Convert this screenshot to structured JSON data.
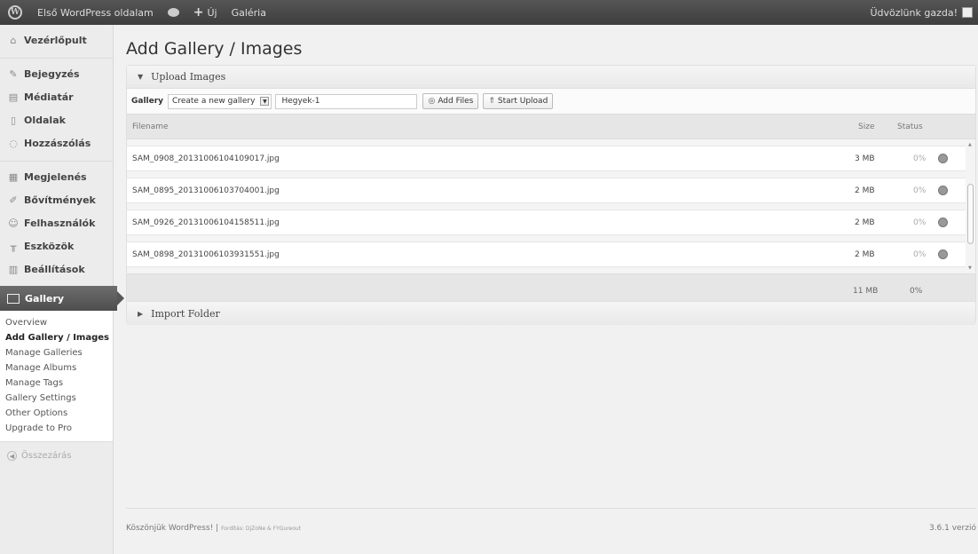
{
  "adminbar": {
    "site_name": "Első WordPress oldalam",
    "new_label": "Új",
    "gallery_link": "Galéria",
    "greeting": "Üdvözlünk gazda!"
  },
  "sidebar": {
    "items": [
      {
        "label": "Vezérlőpult",
        "icon": "dashboard-icon"
      },
      {
        "label": "Bejegyzés",
        "icon": "pin-icon"
      },
      {
        "label": "Médiatár",
        "icon": "media-icon"
      },
      {
        "label": "Oldalak",
        "icon": "page-icon"
      },
      {
        "label": "Hozzászólás",
        "icon": "comment-icon"
      },
      {
        "label": "Megjelenés",
        "icon": "appearance-icon"
      },
      {
        "label": "Bővítmények",
        "icon": "plugin-icon"
      },
      {
        "label": "Felhasználók",
        "icon": "users-icon"
      },
      {
        "label": "Eszközök",
        "icon": "tools-icon"
      },
      {
        "label": "Beállítások",
        "icon": "settings-icon"
      }
    ],
    "gallery_label": "Gallery",
    "submenu": [
      "Overview",
      "Add Gallery / Images",
      "Manage Galleries",
      "Manage Albums",
      "Manage Tags",
      "Gallery Settings",
      "Other Options",
      "Upgrade to Pro"
    ],
    "collapse_label": "Összezárás"
  },
  "main": {
    "title": "Add Gallery / Images",
    "upload_panel_title": "Upload Images",
    "gallery_label": "Gallery",
    "gallery_select": "Create a new gallery",
    "gallery_name": "Hegyek-1",
    "add_files": "Add Files",
    "start_upload": "Start Upload",
    "columns": {
      "filename": "Filename",
      "size": "Size",
      "status": "Status"
    },
    "files": [
      {
        "name": "SAM_0908_20131006104109017.jpg",
        "size": "3 MB",
        "status": "0%"
      },
      {
        "name": "SAM_0895_20131006103704001.jpg",
        "size": "2 MB",
        "status": "0%"
      },
      {
        "name": "SAM_0926_20131006104158511.jpg",
        "size": "2 MB",
        "status": "0%"
      },
      {
        "name": "SAM_0898_20131006103931551.jpg",
        "size": "2 MB",
        "status": "0%"
      }
    ],
    "total_size": "11 MB",
    "total_status": "0%",
    "import_panel_title": "Import Folder"
  },
  "footer": {
    "thanks": "Köszönjük WordPress! |",
    "translators": "Fordítás: DjZoNe & FYGureout",
    "version": "3.6.1 verzió"
  }
}
